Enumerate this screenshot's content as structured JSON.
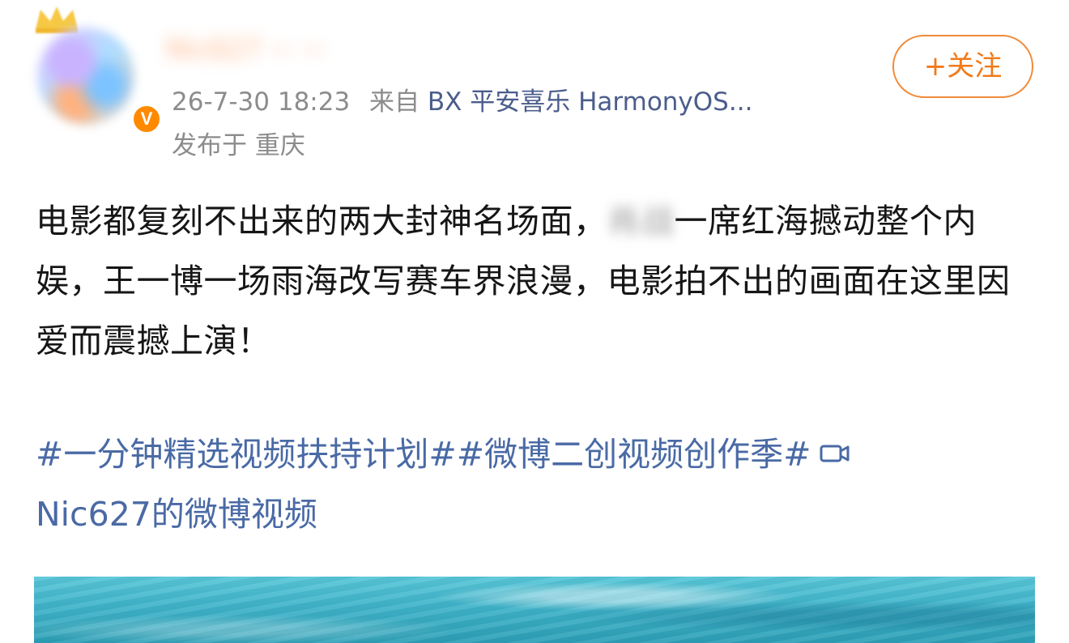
{
  "header": {
    "username": "Nic627 ~ ~",
    "verified_badge": "V",
    "timestamp": "26-7-30 18:23",
    "source_prefix": "来自",
    "device": "BX 平安喜乐 HarmonyOS...",
    "location": "发布于 重庆",
    "follow_label": "+关注"
  },
  "post": {
    "line1_before": "电影都复刻不出来的两大封神名场面，",
    "line1_blurred": "肖战",
    "line1_after": "一席红海撼动整个内娱，王一博一场雨海改写赛车界浪漫，电影拍不出的画面在这里因爱而震撼上演！"
  },
  "hashtags": {
    "tag1": "#一分钟精选视频扶持计划#",
    "tag2": "#微博二创视频创作季#",
    "video_link": "Nic627的微博视频"
  },
  "colors": {
    "accent_orange": "#f27a1a",
    "link_blue": "#4a6aa5",
    "meta_gray": "#8c8c8c",
    "badge_orange": "#ff8a00"
  },
  "icons": [
    "crown-icon",
    "verified-badge-icon",
    "video-camera-icon"
  ]
}
